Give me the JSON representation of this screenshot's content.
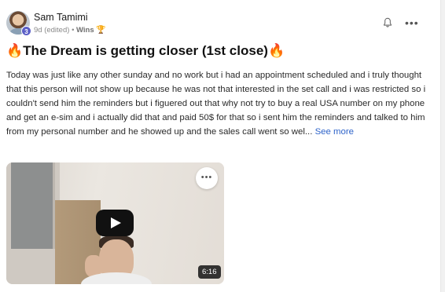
{
  "post": {
    "author": "Sam Tamimi",
    "level": "3",
    "time": "9d (edited)",
    "separator": "•",
    "category": "Wins",
    "category_icon": "trophy-icon",
    "title_emoji": "🔥",
    "title": "The Dream is getting closer (1st close)",
    "body": "Today was just like any other sunday and no work but i had an appointment scheduled and i truly thought that this person will not show up because he was not that interested in the set call and i was restricted so i couldn't send him the reminders but i figuered out that why not try to buy a real USA number on my phone and get an e-sim and i actually did that and paid 50$ for that so i sent him the reminders and talked to him from my personal number and he showed up and the sales call went so wel...",
    "see_more": "See more"
  },
  "video": {
    "duration": "6:16",
    "menu_label": "•••"
  },
  "header_actions": {
    "more_label": "•••"
  },
  "colors": {
    "link": "#2e63c9",
    "level_badge": "#5b5fc7"
  }
}
